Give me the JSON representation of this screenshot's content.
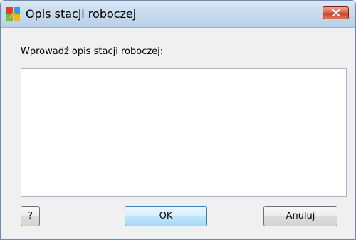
{
  "window": {
    "title": "Opis stacji roboczej",
    "app_icon": "avg-logo-icon",
    "close_icon": "close-icon"
  },
  "dialog": {
    "prompt_label": "Wprowadź opis stacji roboczej:",
    "description_value": "",
    "help_label": "?",
    "ok_label": "OK",
    "cancel_label": "Anuluj"
  },
  "colors": {
    "titlebar": "#c9dbee",
    "close_button": "#c2452c",
    "dialog_background": "#f0f0f0",
    "ok_button_highlight": "#3c7fb1"
  }
}
